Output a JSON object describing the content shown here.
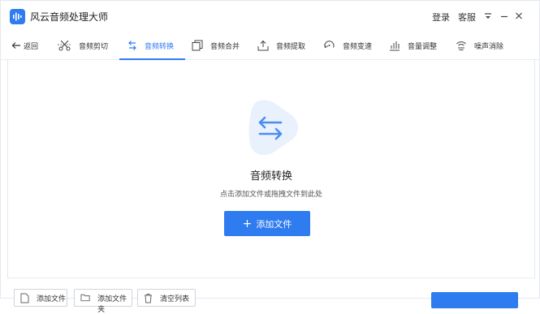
{
  "app": {
    "title": "风云音频处理大师"
  },
  "titlebar": {
    "login": "登录",
    "service": "客服"
  },
  "toolbar": {
    "back": "返回",
    "tabs": [
      {
        "label": "音频剪切",
        "icon": "scissors-icon"
      },
      {
        "label": "音频转换",
        "icon": "convert-icon",
        "active": true
      },
      {
        "label": "音频合并",
        "icon": "merge-icon"
      },
      {
        "label": "音频提取",
        "icon": "extract-icon"
      },
      {
        "label": "音频变速",
        "icon": "speed-icon"
      },
      {
        "label": "音量调整",
        "icon": "volume-bars-icon"
      },
      {
        "label": "噪声消除",
        "icon": "noise-icon"
      }
    ]
  },
  "main": {
    "title": "音频转换",
    "subtitle": "点击添加文件或拖拽文件到此处",
    "add_button": "添加文件"
  },
  "footer": {
    "add_file": "添加文件",
    "add_folder": "添加文件夹",
    "clear_list": "清空列表"
  },
  "colors": {
    "accent": "#2f7bf0",
    "hero_bg": "#e9f1fd"
  }
}
